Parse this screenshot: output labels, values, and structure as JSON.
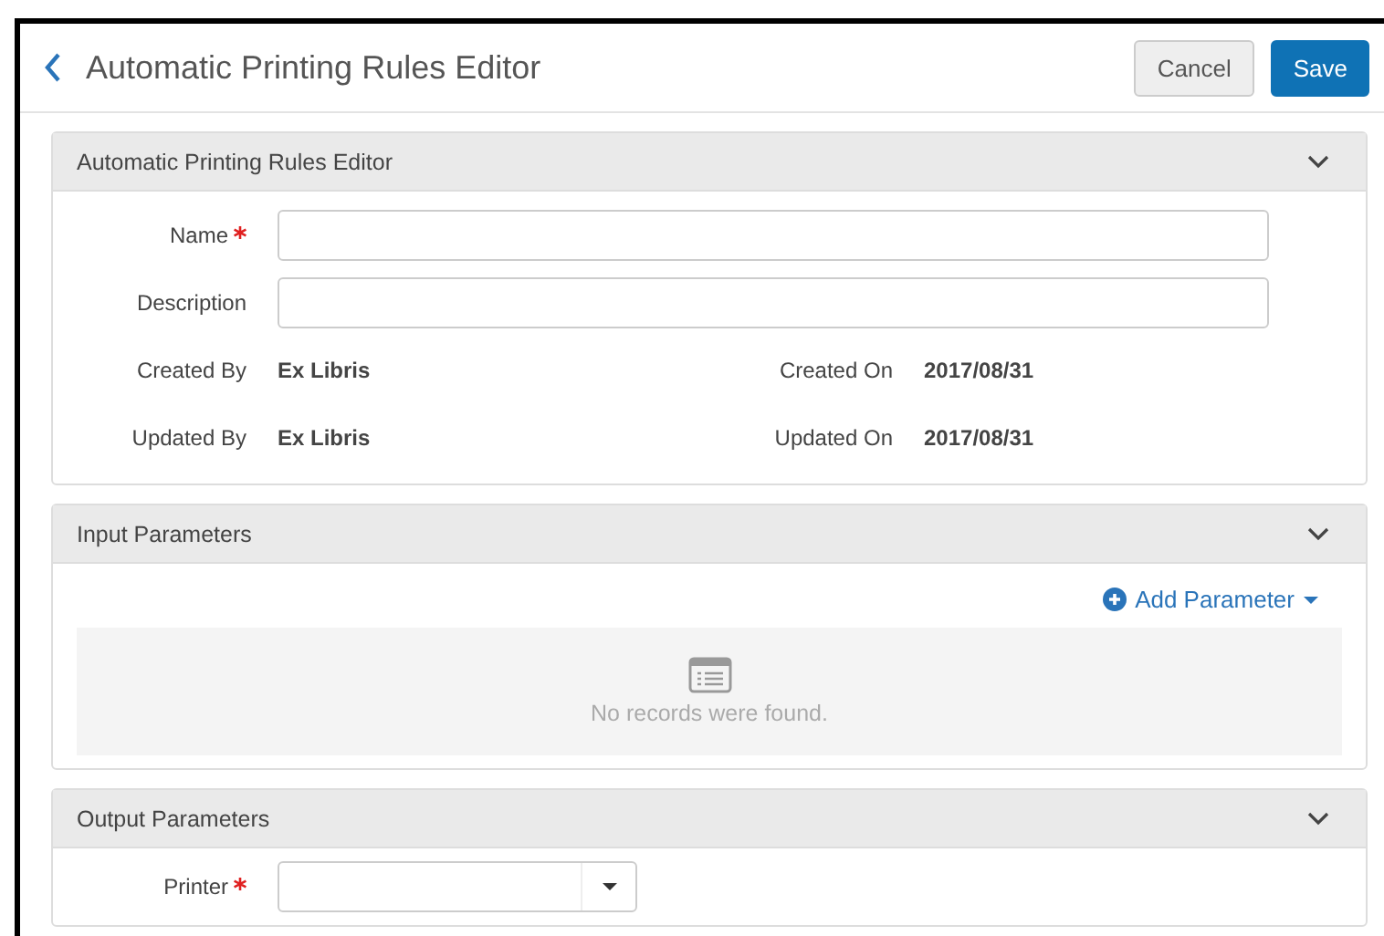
{
  "header": {
    "title": "Automatic Printing Rules Editor",
    "buttons": [
      {
        "label": "Cancel",
        "kind": "secondary"
      },
      {
        "label": "Save",
        "kind": "primary"
      }
    ]
  },
  "sections": [
    {
      "kind": "details",
      "title": "Automatic Printing Rules Editor",
      "fields": [
        {
          "label": "Name",
          "required": true
        },
        {
          "label": "Description",
          "required": false
        }
      ],
      "info": [
        {
          "label": "Created By",
          "value": "Ex Libris"
        },
        {
          "label": "Created On",
          "value": "2017/08/31"
        },
        {
          "label": "Updated By",
          "value": "Ex Libris"
        },
        {
          "label": "Updated On",
          "value": "2017/08/31"
        }
      ]
    },
    {
      "kind": "list",
      "title": "Input Parameters",
      "action": "Add Parameter",
      "empty_text": "No records were found."
    },
    {
      "kind": "select",
      "title": "Output Parameters",
      "fields": [
        {
          "label": "Printer",
          "required": true
        }
      ]
    }
  ]
}
